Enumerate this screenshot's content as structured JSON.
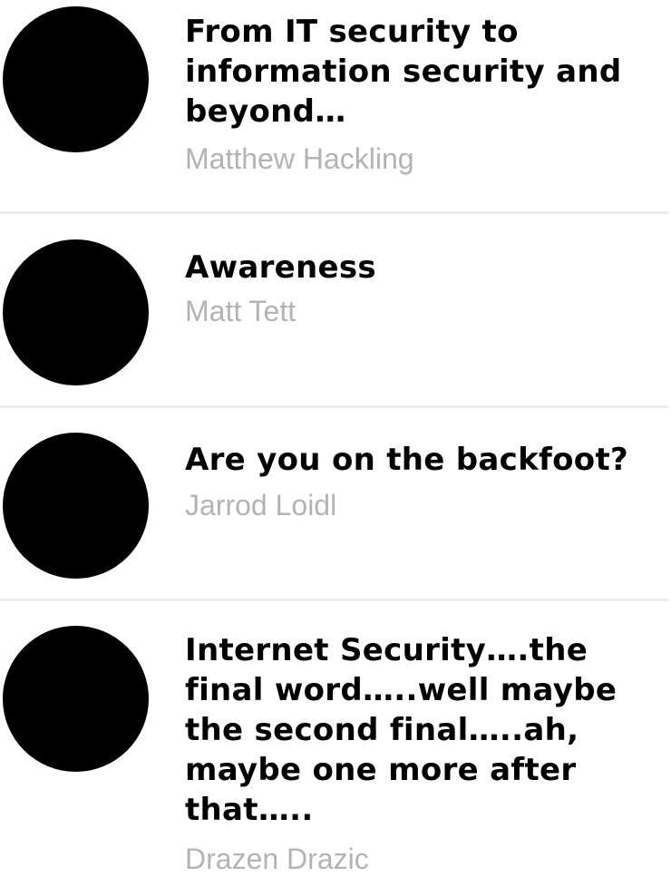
{
  "articles": [
    {
      "title": "From IT security to information security and beyond…",
      "author": "Matthew Hackling",
      "avatar_icon": "avatar-circle"
    },
    {
      "title": "Awareness",
      "author": "Matt Tett",
      "avatar_icon": "avatar-circle"
    },
    {
      "title": "Are you on the backfoot?",
      "author": "Jarrod Loidl",
      "avatar_icon": "avatar-circle"
    },
    {
      "title": "Internet Security….the final word…..well maybe the second final…..ah, maybe one more after that…..",
      "author": "Drazen Drazic",
      "avatar_icon": "avatar-circle"
    }
  ],
  "colors": {
    "title": "#000000",
    "author": "#b3b3b3",
    "divider": "#ececec",
    "avatar": "#000000"
  }
}
